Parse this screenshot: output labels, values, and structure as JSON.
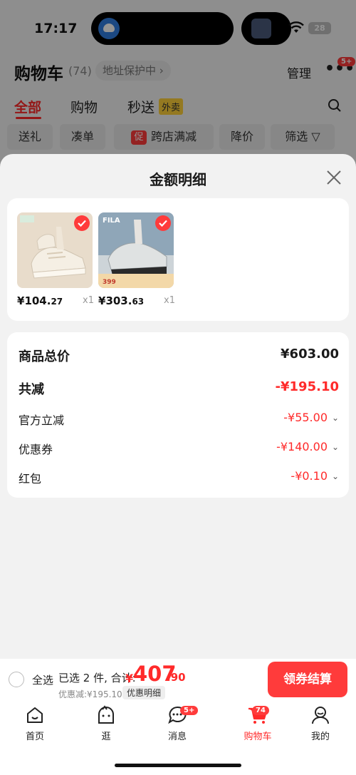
{
  "status_bar": {
    "time": "17:17",
    "battery": "28"
  },
  "cart": {
    "title": "购物车",
    "count": "(74)",
    "address_protect": "地址保护中 ›",
    "manage": "管理",
    "more": "•••",
    "more_badge": "5+"
  },
  "tabs": [
    {
      "label": "全部",
      "active": true
    },
    {
      "label": "购物",
      "active": false
    },
    {
      "label": "秒送",
      "active": false
    }
  ],
  "takeout_badge": "外卖",
  "filters": [
    {
      "label": "送礼"
    },
    {
      "label": "凑单"
    },
    {
      "label": "跨店满减",
      "prefix": "促"
    },
    {
      "label": "降价"
    },
    {
      "label": "筛选 ▽"
    }
  ],
  "sheet": {
    "title": "金额明细",
    "products": [
      {
        "currency": "¥",
        "price_int": "104.",
        "price_dec": "27",
        "qty": "x1"
      },
      {
        "currency": "¥",
        "price_int": "303.",
        "price_dec": "63",
        "qty": "x1",
        "brand": "FILA",
        "promo": "399"
      }
    ],
    "rows": [
      {
        "label": "商品总价",
        "value": "¥603.00"
      },
      {
        "label": "共减",
        "value": "-¥195.10"
      },
      {
        "label": "官方立减",
        "value": "-¥55.00"
      },
      {
        "label": "优惠券",
        "value": "-¥140.00"
      },
      {
        "label": "红包",
        "value": "-¥0.10"
      }
    ]
  },
  "checkout": {
    "select_all": "全选",
    "selected_info": "已选 2 件, 合计:",
    "currency": "¥",
    "total_int": "407",
    "total_dec": ".90",
    "discount": "优惠减:¥195.10",
    "detail_link": "优惠明细",
    "pay_button": "领券结算"
  },
  "tabbar": [
    {
      "label": "首页",
      "icon": "home-icon"
    },
    {
      "label": "逛",
      "icon": "browse-icon"
    },
    {
      "label": "消息",
      "icon": "message-icon",
      "badge": "5+"
    },
    {
      "label": "购物车",
      "icon": "cart-icon",
      "badge": "74",
      "active": true
    },
    {
      "label": "我的",
      "icon": "profile-icon"
    }
  ],
  "colors": {
    "accent": "#ff2a2a",
    "badge": "#ff3b3b",
    "takeout": "#ffd13a"
  }
}
